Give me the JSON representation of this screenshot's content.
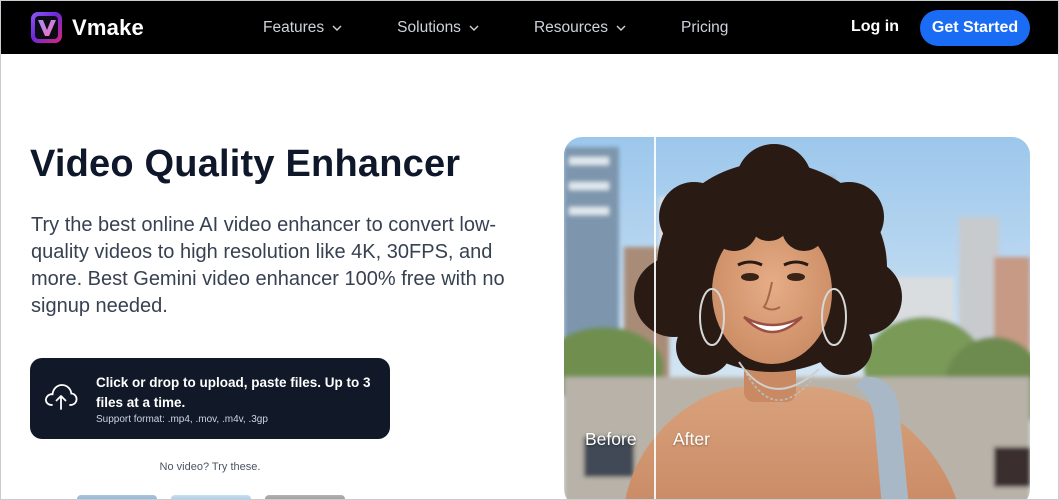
{
  "brand": {
    "name": "Vmake",
    "logo_letter": "V",
    "logo_icon": "vmake-logo-icon"
  },
  "nav": {
    "items": [
      {
        "label": "Features",
        "has_dropdown": true
      },
      {
        "label": "Solutions",
        "has_dropdown": true
      },
      {
        "label": "Resources",
        "has_dropdown": true
      },
      {
        "label": "Pricing",
        "has_dropdown": false
      }
    ],
    "login_label": "Log in",
    "cta_label": "Get Started"
  },
  "hero": {
    "title": "Video Quality Enhancer",
    "description": "Try the best online AI video enhancer to convert low-quality videos to high resolution like 4K, 30FPS, and more. Best Gemini video enhancer 100% free with no signup needed."
  },
  "upload": {
    "icon": "cloud-upload-icon",
    "main_text": "Click or drop to upload, paste files. Up to 3 files at a time.",
    "support_text": "Support format: .mp4, .mov, .m4v, .3gp"
  },
  "samples": {
    "label": "No video? Try these."
  },
  "compare": {
    "before_label": "Before",
    "after_label": "After"
  },
  "colors": {
    "nav_bg": "#000000",
    "accent": "#1a6cf5",
    "upload_bg": "#111827",
    "title": "#0f172a"
  }
}
